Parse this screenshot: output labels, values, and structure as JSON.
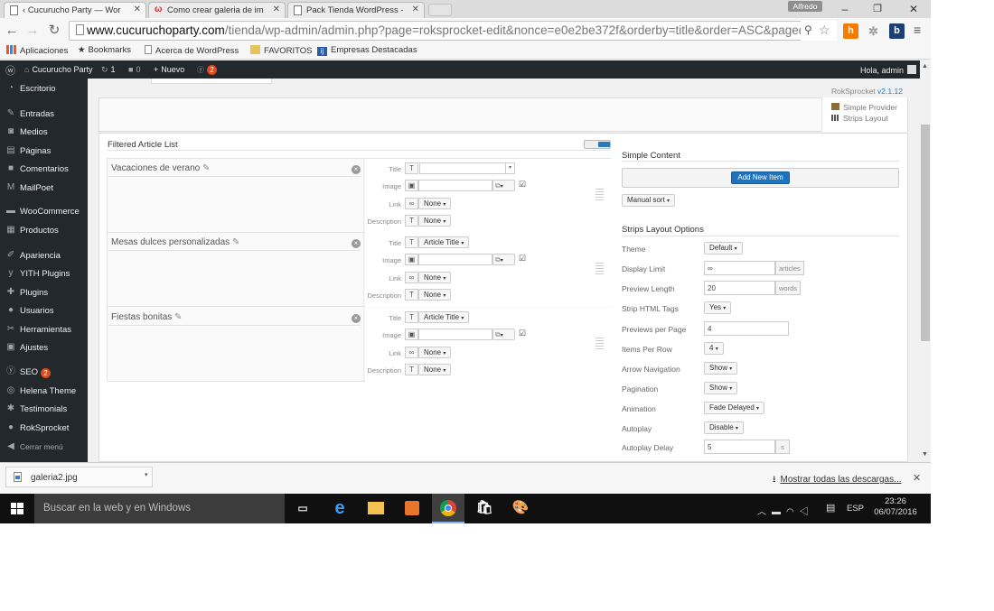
{
  "browser": {
    "tabs": [
      {
        "label": "Cucurucho Party — Wor",
        "prefix": "‹"
      },
      {
        "label": "Como crear galeria de im"
      },
      {
        "label": "Pack Tienda WordPress -"
      }
    ],
    "profile_name": "Alfredo",
    "url_host": "www.cucuruchoparty.com",
    "url_path": "/tienda/wp-admin/admin.php?page=roksprocket-edit&nonce=e0e2be372f&orderby=title&order=ASC&paged=1",
    "bookmarks": [
      "Aplicaciones",
      "Bookmarks",
      "Acerca de WordPress",
      "FAVORITOS",
      "Empresas Destacadas"
    ]
  },
  "adminbar": {
    "site_name": "Cucurucho Party",
    "updates_count": "1",
    "comments_count": "0",
    "new_label": "Nuevo",
    "seo_count": "2",
    "greeting": "Hola, admin"
  },
  "sidebar": {
    "items": [
      {
        "label": "Escritorio",
        "icon": "dashboard-icon"
      },
      {
        "label": "Entradas",
        "icon": "pin-icon"
      },
      {
        "label": "Medios",
        "icon": "media-icon"
      },
      {
        "label": "Páginas",
        "icon": "pages-icon"
      },
      {
        "label": "Comentarios",
        "icon": "comments-icon"
      },
      {
        "label": "MailPoet",
        "icon": "mailpoet-icon"
      },
      {
        "label": "WooCommerce",
        "icon": "woocommerce-icon"
      },
      {
        "label": "Productos",
        "icon": "products-icon"
      },
      {
        "label": "Apariencia",
        "icon": "appearance-icon"
      },
      {
        "label": "YITH Plugins",
        "icon": "yith-icon"
      },
      {
        "label": "Plugins",
        "icon": "plugins-icon"
      },
      {
        "label": "Usuarios",
        "icon": "users-icon"
      },
      {
        "label": "Herramientas",
        "icon": "tools-icon"
      },
      {
        "label": "Ajustes",
        "icon": "settings-icon"
      },
      {
        "label": "SEO",
        "icon": "seo-icon",
        "badge": "2"
      },
      {
        "label": "Helena Theme",
        "icon": "theme-icon"
      },
      {
        "label": "Testimonials",
        "icon": "testimonials-icon"
      },
      {
        "label": "RokSprocket",
        "icon": "roksprocket-icon"
      }
    ],
    "collapse_label": "Cerrar menú"
  },
  "roksprocket": {
    "version_prefix": "RokSprocket",
    "version": "v2.1.12",
    "provider_label": "Simple Provider",
    "layout_label": "Strips Layout"
  },
  "article_list": {
    "title": "Filtered Article List",
    "field_labels": {
      "title": "Title",
      "image": "Image",
      "link": "Link",
      "description": "Description"
    },
    "articles": [
      {
        "name": "Vacaciones de verano",
        "title_value": "",
        "link_value": "None",
        "description_value": "None"
      },
      {
        "name": "Mesas dulces personalizadas",
        "title_value": "Article Title",
        "link_value": "None",
        "description_value": "None"
      },
      {
        "name": "Fiestas bonitas",
        "title_value": "Article Title",
        "link_value": "None",
        "description_value": "None"
      }
    ]
  },
  "simple_content": {
    "title": "Simple Content",
    "add_button": "Add New Item",
    "sort_label": "Manual sort"
  },
  "layout_options": {
    "title": "Strips Layout Options",
    "rows": [
      {
        "label": "Theme",
        "type": "select",
        "value": "Default"
      },
      {
        "label": "Display Limit",
        "type": "input",
        "value": "∞",
        "suffix": "articles"
      },
      {
        "label": "Preview Length",
        "type": "input",
        "value": "20",
        "suffix": "words"
      },
      {
        "label": "Strip HTML Tags",
        "type": "select",
        "value": "Yes"
      },
      {
        "label": "Previews per Page",
        "type": "input",
        "value": "4",
        "suffix": ""
      },
      {
        "label": "Items Per Row",
        "type": "select",
        "value": "4"
      },
      {
        "label": "Arrow Navigation",
        "type": "select",
        "value": "Show"
      },
      {
        "label": "Pagination",
        "type": "select",
        "value": "Show"
      },
      {
        "label": "Animation",
        "type": "select",
        "value": "Fade Delayed"
      },
      {
        "label": "Autoplay",
        "type": "select",
        "value": "Disable"
      },
      {
        "label": "Autoplay Delay",
        "type": "input",
        "value": "5",
        "suffix": "s"
      }
    ]
  },
  "downloads": {
    "file": "galeria2.jpg",
    "show_all": "Mostrar todas las descargas..."
  },
  "taskbar": {
    "search_placeholder": "Buscar en la web y en Windows",
    "language": "ESP",
    "time": "23:26",
    "date": "06/07/2016"
  }
}
